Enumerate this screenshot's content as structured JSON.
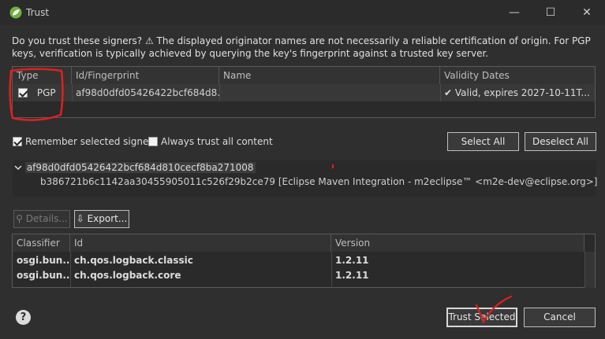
{
  "window": {
    "title": "Trust",
    "minimize_glyph": "—",
    "maximize_glyph": "☐",
    "close_glyph": "✕"
  },
  "prompt": {
    "text": "Do you trust these signers?  ⚠ The displayed originator names are not necessarily a reliable certification of origin.  For PGP keys, verification is typically achieved by querying the key's fingerprint against a trusted key server."
  },
  "signers_table": {
    "headers": [
      "Type",
      "Id/Fingerprint",
      "Name",
      "Validity Dates"
    ],
    "rows": [
      {
        "checked": true,
        "type": "PGP",
        "fingerprint": "af98d0dfd05426422bcf684d8...",
        "name": "",
        "validity_mark": "✔",
        "validity": "Valid, expires 2027-10-11T..."
      }
    ]
  },
  "options": {
    "remember_label": "Remember selected signers",
    "remember_checked": true,
    "always_trust_label": "Always trust all content",
    "always_trust_checked": false,
    "select_all_label": "Select All",
    "deselect_all_label": "Deselect All"
  },
  "key_tree": {
    "root": "af98d0dfd05426422bcf684d810cecf8ba271008",
    "child": "b386721b6c1142aa30455905011c526f29b2ce79 [Eclipse Maven Integration - m2eclipse™ <m2e-dev@eclipse.org>]"
  },
  "actions": {
    "details_label": "Details...",
    "export_label": "Export..."
  },
  "artifacts_table": {
    "headers": [
      "Classifier",
      "Id",
      "Version"
    ],
    "rows": [
      {
        "classifier": "osgi.bun...",
        "id": "ch.qos.logback.classic",
        "version": "1.2.11"
      },
      {
        "classifier": "osgi.bun...",
        "id": "ch.qos.logback.core",
        "version": "1.2.11"
      }
    ]
  },
  "footer": {
    "help_glyph": "?",
    "trust_selected_label": "Trust Selected",
    "cancel_label": "Cancel"
  },
  "colors": {
    "background": "#2f2f2f",
    "annotation_red": "#e02020",
    "spring_green": "#6db33f"
  }
}
